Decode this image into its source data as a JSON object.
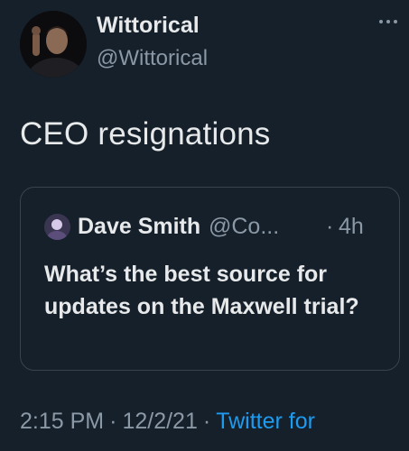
{
  "author": {
    "display_name": "Wittorical",
    "handle": "@Wittorical"
  },
  "menu": {
    "icon": "more-horizontal-icon"
  },
  "tweet": {
    "text": "CEO resignations"
  },
  "quoted_tweet": {
    "display_name": "Dave Smith",
    "handle": "@Co...",
    "separator": "·",
    "time": "4h",
    "text": "What’s the best source for updates on the Maxwell trial?"
  },
  "meta": {
    "time": "2:15 PM",
    "separator1": "·",
    "date": "12/2/21",
    "separator2": "·",
    "source": "Twitter for"
  },
  "colors": {
    "background": "#15202b",
    "text_primary": "#e7e9ea",
    "text_secondary": "#8b98a5",
    "accent": "#1d9bf0",
    "border": "#38444d"
  }
}
